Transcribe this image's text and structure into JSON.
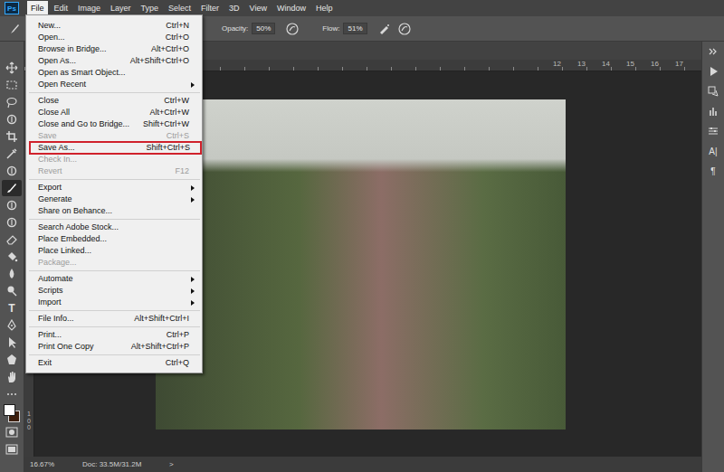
{
  "app": {
    "logo": "Ps"
  },
  "menubar": [
    {
      "label": "File",
      "selected": true
    },
    {
      "label": "Edit",
      "selected": false
    },
    {
      "label": "Image",
      "selected": false
    },
    {
      "label": "Layer",
      "selected": false
    },
    {
      "label": "Type",
      "selected": false
    },
    {
      "label": "Select",
      "selected": false
    },
    {
      "label": "Filter",
      "selected": false
    },
    {
      "label": "3D",
      "selected": false
    },
    {
      "label": "View",
      "selected": false
    },
    {
      "label": "Window",
      "selected": false
    },
    {
      "label": "Help",
      "selected": false
    }
  ],
  "options_bar": {
    "opacity_label": "Opacity:",
    "opacity_value": "50%",
    "flow_label": "Flow:",
    "flow_value": "51%"
  },
  "tools": [
    {
      "glyph": "",
      "selected": false
    },
    {
      "glyph": "",
      "selected": false
    },
    {
      "glyph": "",
      "selected": false
    },
    {
      "glyph": "",
      "selected": false
    },
    {
      "glyph": "",
      "selected": false
    },
    {
      "glyph": "",
      "selected": false
    },
    {
      "glyph": "",
      "selected": false
    },
    {
      "glyph": "",
      "selected": true
    },
    {
      "glyph": "",
      "selected": false
    },
    {
      "glyph": "",
      "selected": false
    },
    {
      "glyph": "",
      "selected": false
    },
    {
      "glyph": "",
      "selected": false
    },
    {
      "glyph": "",
      "selected": false
    },
    {
      "glyph": "",
      "selected": false
    },
    {
      "glyph": "T",
      "selected": false
    },
    {
      "glyph": "",
      "selected": false
    },
    {
      "glyph": "",
      "selected": false
    },
    {
      "glyph": "",
      "selected": false
    },
    {
      "glyph": "",
      "selected": false
    }
  ],
  "ruler": {
    "top": [
      "12",
      "13",
      "14",
      "15",
      "16",
      "17"
    ],
    "left": "100"
  },
  "right_dock": {
    "glyphs": [
      "A|",
      "¶"
    ]
  },
  "status_bar": {
    "zoom": "16.67%",
    "doc": "Doc: 33.5M/31.2M",
    "arrow": ">"
  },
  "file_menu": {
    "groups": [
      [
        {
          "label": "New...",
          "shortcut": "Ctrl+N",
          "submenu": false,
          "disabled": false,
          "outlined": false
        },
        {
          "label": "Open...",
          "shortcut": "Ctrl+O",
          "submenu": false,
          "disabled": false,
          "outlined": false
        },
        {
          "label": "Browse in Bridge...",
          "shortcut": "Alt+Ctrl+O",
          "submenu": false,
          "disabled": false,
          "outlined": false
        },
        {
          "label": "Open As...",
          "shortcut": "Alt+Shift+Ctrl+O",
          "submenu": false,
          "disabled": false,
          "outlined": false
        },
        {
          "label": "Open as Smart Object...",
          "shortcut": "",
          "submenu": false,
          "disabled": false,
          "outlined": false
        },
        {
          "label": "Open Recent",
          "shortcut": "",
          "submenu": true,
          "disabled": false,
          "outlined": false
        }
      ],
      [
        {
          "label": "Close",
          "shortcut": "Ctrl+W",
          "submenu": false,
          "disabled": false,
          "outlined": false
        },
        {
          "label": "Close All",
          "shortcut": "Alt+Ctrl+W",
          "submenu": false,
          "disabled": false,
          "outlined": false
        },
        {
          "label": "Close and Go to Bridge...",
          "shortcut": "Shift+Ctrl+W",
          "submenu": false,
          "disabled": false,
          "outlined": false
        },
        {
          "label": "Save",
          "shortcut": "Ctrl+S",
          "submenu": false,
          "disabled": true,
          "outlined": false
        },
        {
          "label": "Save As...",
          "shortcut": "Shift+Ctrl+S",
          "submenu": false,
          "disabled": false,
          "outlined": true
        },
        {
          "label": "Check In...",
          "shortcut": "",
          "submenu": false,
          "disabled": true,
          "outlined": false
        },
        {
          "label": "Revert",
          "shortcut": "F12",
          "submenu": false,
          "disabled": true,
          "outlined": false
        }
      ],
      [
        {
          "label": "Export",
          "shortcut": "",
          "submenu": true,
          "disabled": false,
          "outlined": false
        },
        {
          "label": "Generate",
          "shortcut": "",
          "submenu": true,
          "disabled": false,
          "outlined": false
        },
        {
          "label": "Share on Behance...",
          "shortcut": "",
          "submenu": false,
          "disabled": false,
          "outlined": false
        }
      ],
      [
        {
          "label": "Search Adobe Stock...",
          "shortcut": "",
          "submenu": false,
          "disabled": false,
          "outlined": false
        },
        {
          "label": "Place Embedded...",
          "shortcut": "",
          "submenu": false,
          "disabled": false,
          "outlined": false
        },
        {
          "label": "Place Linked...",
          "shortcut": "",
          "submenu": false,
          "disabled": false,
          "outlined": false
        },
        {
          "label": "Package...",
          "shortcut": "",
          "submenu": false,
          "disabled": true,
          "outlined": false
        }
      ],
      [
        {
          "label": "Automate",
          "shortcut": "",
          "submenu": true,
          "disabled": false,
          "outlined": false
        },
        {
          "label": "Scripts",
          "shortcut": "",
          "submenu": true,
          "disabled": false,
          "outlined": false
        },
        {
          "label": "Import",
          "shortcut": "",
          "submenu": true,
          "disabled": false,
          "outlined": false
        }
      ],
      [
        {
          "label": "File Info...",
          "shortcut": "Alt+Shift+Ctrl+I",
          "submenu": false,
          "disabled": false,
          "outlined": false
        }
      ],
      [
        {
          "label": "Print...",
          "shortcut": "Ctrl+P",
          "submenu": false,
          "disabled": false,
          "outlined": false
        },
        {
          "label": "Print One Copy",
          "shortcut": "Alt+Shift+Ctrl+P",
          "submenu": false,
          "disabled": false,
          "outlined": false
        }
      ],
      [
        {
          "label": "Exit",
          "shortcut": "Ctrl+Q",
          "submenu": false,
          "disabled": false,
          "outlined": false
        }
      ]
    ]
  }
}
